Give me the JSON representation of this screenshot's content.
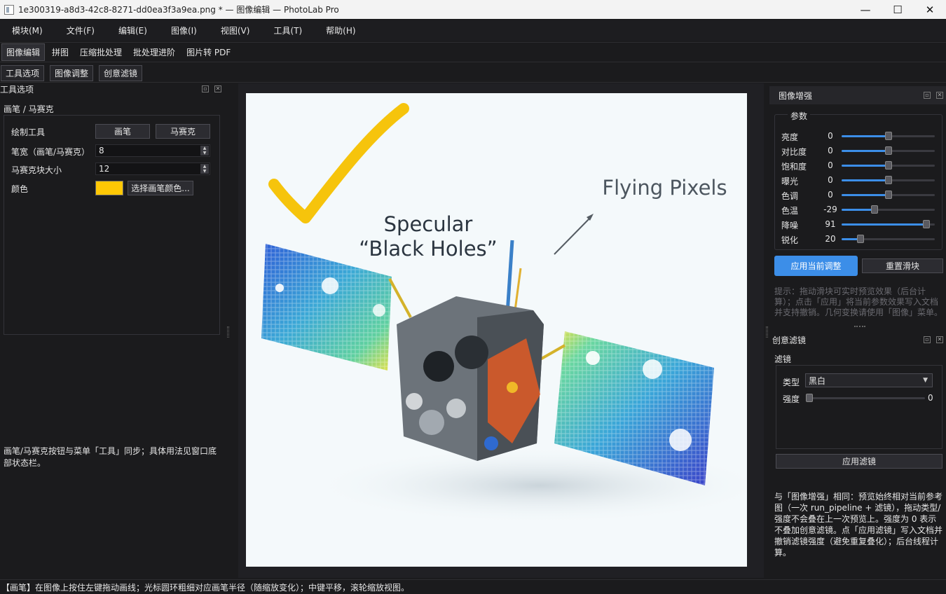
{
  "window": {
    "title": "1e300319-a8d3-42c8-8271-dd0ea3f3a9ea.png * — 图像编辑 — PhotoLab Pro",
    "minimize": "—",
    "maximize": "☐",
    "close": "✕"
  },
  "menubar": [
    "模块(M)",
    "文件(F)",
    "编辑(E)",
    "图像(I)",
    "视图(V)",
    "工具(T)",
    "帮助(H)"
  ],
  "module_tabs": [
    "图像编辑",
    "拼图",
    "压缩批处理",
    "批处理进阶",
    "图片转 PDF"
  ],
  "dock_toggles": [
    "工具选项",
    "图像调整",
    "创意滤镜"
  ],
  "tool_options": {
    "header": "工具选项",
    "section": "画笔 / 马赛克",
    "draw_tool_label": "绘制工具",
    "brush_button": "画笔",
    "mosaic_button": "马赛克",
    "width_label": "笔宽（画笔/马赛克）",
    "width_value": "8",
    "block_label": "马赛克块大小",
    "block_value": "12",
    "color_label": "颜色",
    "color_value": "#ffc805",
    "choose_color_button": "选择画笔颜色...",
    "note": "画笔/马赛克按钮与菜单「工具」同步；具体用法见窗口底部状态栏。"
  },
  "image": {
    "annotation_1": "Specular",
    "annotation_2": "“Black Holes”",
    "annotation_3": "Flying Pixels"
  },
  "enhance": {
    "header": "图像增强",
    "group": "参数",
    "params": [
      {
        "label": "亮度",
        "value": "0",
        "level": 0.5
      },
      {
        "label": "对比度",
        "value": "0",
        "level": 0.5
      },
      {
        "label": "饱和度",
        "value": "0",
        "level": 0.5
      },
      {
        "label": "曝光",
        "value": "0",
        "level": 0.5
      },
      {
        "label": "色调",
        "value": "0",
        "level": 0.5
      },
      {
        "label": "色温",
        "value": "-29",
        "level": 0.355
      },
      {
        "label": "降噪",
        "value": "91",
        "level": 0.91
      },
      {
        "label": "锐化",
        "value": "20",
        "level": 0.2
      }
    ],
    "apply_button": "应用当前调整",
    "reset_button": "重置滑块",
    "tip": "提示：拖动滑块可实时预览效果（后台计算）；点击「应用」将当前参数效果写入文档并支持撤销。几何变换请使用「图像」菜单。"
  },
  "filter": {
    "header": "创意滤镜",
    "group": "滤镜",
    "type_label": "类型",
    "type_value": "黑白",
    "strength_label": "强度",
    "strength_value": "0",
    "apply_button": "应用滤镜",
    "note": "与「图像增强」相同：预览始终相对当前参考图（一次 run_pipeline + 滤镜），拖动类型/强度不会叠在上一次预览上。强度为 0 表示不叠加创意滤镜。点「应用滤镜」写入文档并撤销滤镜强度（避免重复叠化）；后台线程计算。"
  },
  "status": "【画笔】在图像上按住左键拖动画线；光标圆环粗细对应画笔半径（随缩放变化）；中键平移，滚轮缩放视图。",
  "icons": {
    "float": "▫",
    "close": "✕"
  }
}
